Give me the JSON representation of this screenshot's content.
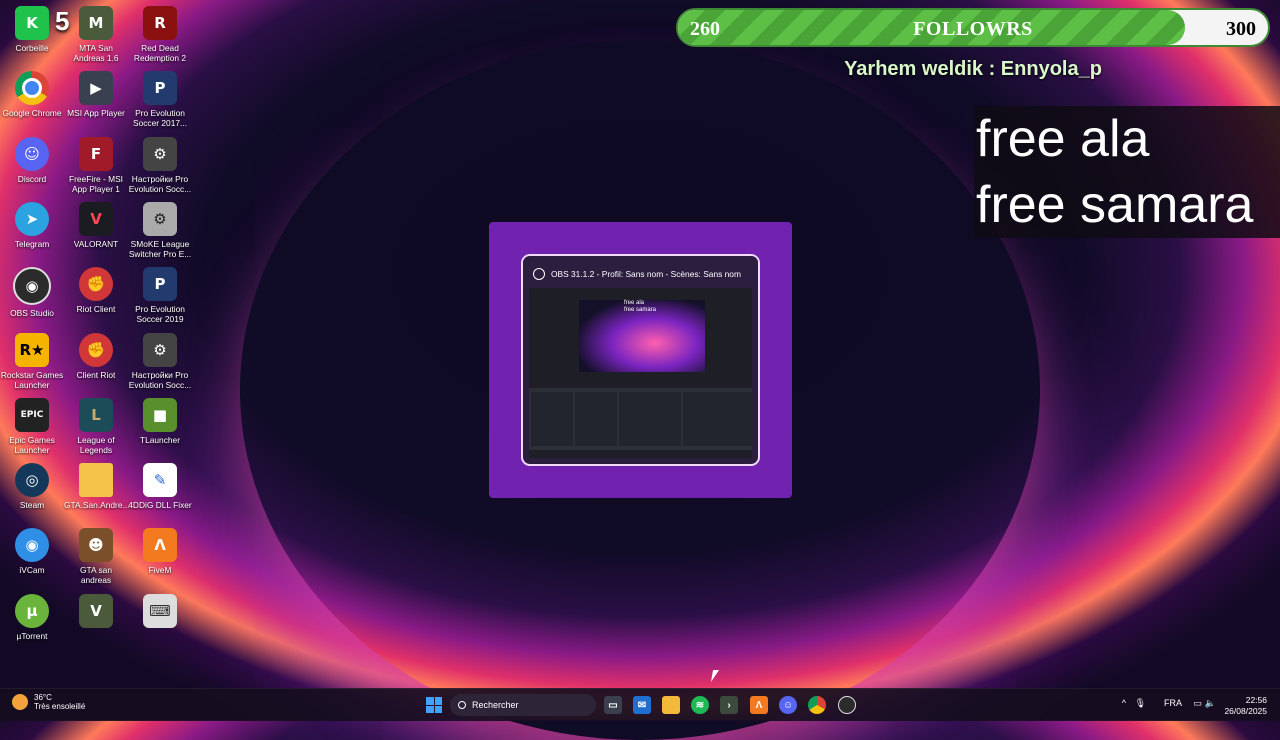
{
  "desktop": {
    "counter": "5",
    "icons": [
      {
        "label": "Corbeille",
        "glyph": "K"
      },
      {
        "label": "MTA San Andreas 1.6",
        "glyph": "M"
      },
      {
        "label": "Red Dead Redemption 2",
        "glyph": "R"
      },
      {
        "label": "Google Chrome",
        "glyph": ""
      },
      {
        "label": "MSI App Player",
        "glyph": "▶"
      },
      {
        "label": "Pro Evolution Soccer 2017...",
        "glyph": "P"
      },
      {
        "label": "Discord",
        "glyph": "☺"
      },
      {
        "label": "FreeFire - MSI App Player 1",
        "glyph": "F"
      },
      {
        "label": "Настройки Pro Evolution Socc...",
        "glyph": "⚙"
      },
      {
        "label": "Telegram",
        "glyph": "➤"
      },
      {
        "label": "VALORANT",
        "glyph": "V"
      },
      {
        "label": "SMoKE League Switcher Pro E...",
        "glyph": "⚙"
      },
      {
        "label": "OBS Studio",
        "glyph": "◉"
      },
      {
        "label": "Riot Client",
        "glyph": "✊"
      },
      {
        "label": "Pro Evolution Soccer 2019",
        "glyph": "P"
      },
      {
        "label": "Rockstar Games Launcher",
        "glyph": "R★"
      },
      {
        "label": "Client Riot",
        "glyph": "✊"
      },
      {
        "label": "Настройки Pro Evolution Socc...",
        "glyph": "⚙"
      },
      {
        "label": "Epic Games Launcher",
        "glyph": "EPIC"
      },
      {
        "label": "League of Legends",
        "glyph": "L"
      },
      {
        "label": "TLauncher",
        "glyph": "■"
      },
      {
        "label": "Steam",
        "glyph": "◎"
      },
      {
        "label": "GTA.San.Andre...",
        "glyph": ""
      },
      {
        "label": "4DDiG DLL Fixer",
        "glyph": "✎"
      },
      {
        "label": "iVCam",
        "glyph": "◉"
      },
      {
        "label": "GTA san andreas",
        "glyph": "☻"
      },
      {
        "label": "FiveM",
        "glyph": "Λ"
      },
      {
        "label": "µTorrent",
        "glyph": "µ"
      },
      {
        "label": "",
        "glyph": "V"
      },
      {
        "label": "",
        "glyph": "⌨"
      }
    ]
  },
  "overlay": {
    "follow_min": "260",
    "follow_title": "FOLLOWRS",
    "follow_max": "300",
    "follow_progress": 0.86,
    "shoutout": "Yarhem weldik : Ennyola_p",
    "free_lines": [
      "free ala",
      "free samara"
    ]
  },
  "obs_preview": {
    "title": "OBS 31.1.2 - Profil: Sans nom - Scènes: Sans nom",
    "mini_text": [
      "free ala",
      "free samara"
    ]
  },
  "taskbar": {
    "weather_temp": "36°C",
    "weather_desc": "Très ensoleillé",
    "search_placeholder": "Rechercher",
    "language": "FRA",
    "time": "22:56",
    "date": "26/08/2025"
  },
  "colors": {
    "accent_green": "#5dbf45",
    "start_blue": "#3fa3ff",
    "thumb_purple": "#8228c8"
  }
}
